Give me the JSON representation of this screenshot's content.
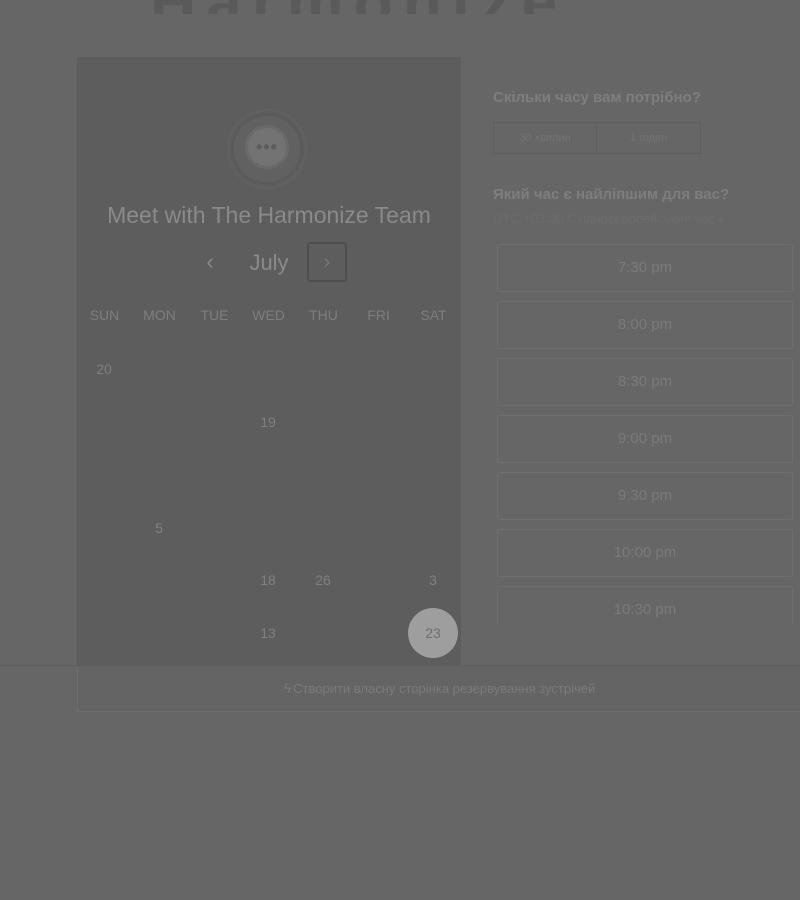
{
  "header": {
    "logo_text": "Harmonize"
  },
  "left_panel": {
    "avatar_icon": "chat-bubble-icon",
    "avatar_dots": "•••",
    "title": "Meet with The Harmonize Team",
    "month": "July",
    "prev_glyph": "‹",
    "next_glyph": "›",
    "weekdays": [
      "SUN",
      "MON",
      "TUE",
      "WED",
      "THU",
      "FRI",
      "SAT"
    ],
    "days": [
      {
        "label": "20",
        "col": 0,
        "row": 0,
        "selected": false
      },
      {
        "label": "19",
        "col": 3,
        "row": 1,
        "selected": false
      },
      {
        "label": "5",
        "col": 1,
        "row": 3,
        "selected": false
      },
      {
        "label": "18",
        "col": 3,
        "row": 4,
        "selected": false
      },
      {
        "label": "26",
        "col": 4,
        "row": 4,
        "selected": false
      },
      {
        "label": "3",
        "col": 6,
        "row": 4,
        "selected": false
      },
      {
        "label": "13",
        "col": 3,
        "row": 5,
        "selected": true
      },
      {
        "label": "23",
        "col": 6,
        "row": 5,
        "selected": true
      }
    ]
  },
  "right_panel": {
    "duration_title": "Скільки часу вам потрібно?",
    "durations": [
      "30 хвилин",
      "1 годин"
    ],
    "time_title": "Який час є найліпшим для вас?",
    "timezone": "UTC +03:00 Східноєвропейський час",
    "timezone_caret": "▾",
    "slots": [
      "7:30 pm",
      "8:00 pm",
      "8:30 pm",
      "9:00 pm",
      "9:30 pm",
      "10:00 pm",
      "10:30 pm"
    ]
  },
  "footer": {
    "icon": "sprocket-icon",
    "icon_glyph": "ϟ",
    "link_text": "Створити власну сторінка резервування зустрічей"
  }
}
